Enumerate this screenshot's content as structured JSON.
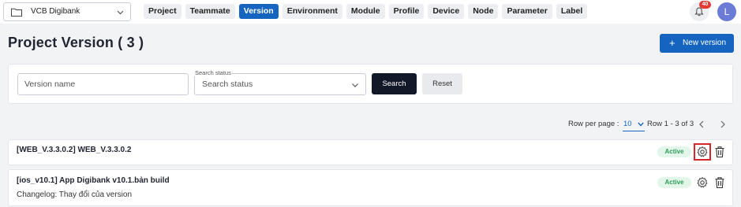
{
  "topbar": {
    "project_select": {
      "value": "VCB Digibank",
      "icon": "folder-icon"
    },
    "nav": [
      {
        "label": "Project",
        "active": false
      },
      {
        "label": "Teammate",
        "active": false
      },
      {
        "label": "Version",
        "active": true
      },
      {
        "label": "Environment",
        "active": false
      },
      {
        "label": "Module",
        "active": false
      },
      {
        "label": "Profile",
        "active": false
      },
      {
        "label": "Device",
        "active": false
      },
      {
        "label": "Node",
        "active": false
      },
      {
        "label": "Parameter",
        "active": false
      },
      {
        "label": "Label",
        "active": false
      }
    ],
    "notification_count": "40",
    "avatar_initial": "L"
  },
  "header": {
    "title": "Project Version ( 3 )",
    "new_version_label": "New version",
    "new_version_icon": "plus-icon"
  },
  "filter": {
    "version_name_placeholder": "Version name",
    "status_legend": "Search status",
    "status_placeholder": "Search status",
    "search_label": "Search",
    "reset_label": "Reset"
  },
  "pagination": {
    "rows_per_page_label": "Row per page :",
    "rows_per_page_value": "10",
    "range_text": "Row 1 - 3 of 3"
  },
  "versions": [
    {
      "title": "[WEB_V.3.3.0.2] WEB_V.3.3.0.2",
      "changelog": "",
      "status": "Active"
    },
    {
      "title": "[ios_v10.1] App Digibank v10.1.bản build",
      "changelog": "Changelog: Thay đổi của version",
      "status": "Active"
    }
  ],
  "colors": {
    "primary": "#1565c0",
    "active_pill_bg": "#e2f6e9",
    "active_pill_text": "#2e9d5a",
    "highlight_border": "#d62828",
    "badge": "#e53935"
  }
}
